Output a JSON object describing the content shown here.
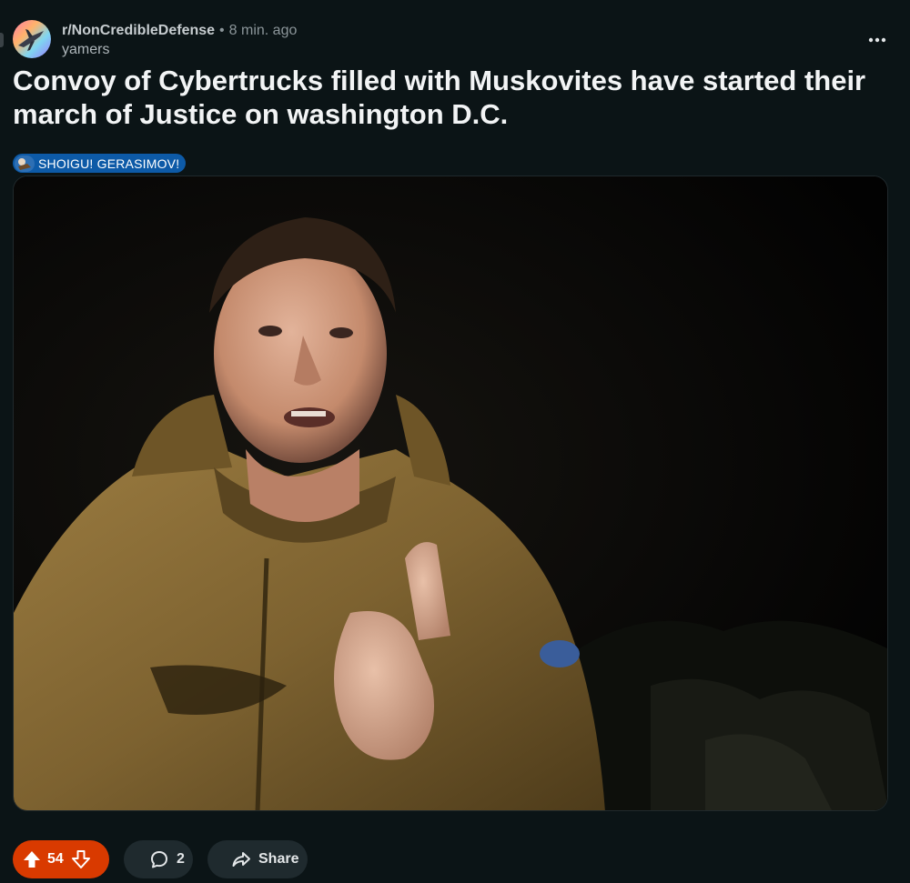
{
  "post": {
    "subreddit": "r/NonCredibleDefense",
    "separator": "•",
    "time_ago": "8 min. ago",
    "author": "yamers",
    "title": "Convoy of Cybertrucks filled with Muskovites have started their march of Justice on washington D.C.",
    "flair": {
      "text": "SHOIGU! GERASIMOV!",
      "color": "#0d5aa7"
    },
    "image_alt": "Photo of a man in an olive hooded jacket pointing at the camera at night"
  },
  "actions": {
    "vote_count": "54",
    "comment_count": "2",
    "share_label": "Share"
  },
  "icons": {
    "more": "more-options-icon",
    "upvote": "upvote-arrow-icon",
    "downvote": "downvote-arrow-icon",
    "comment": "comment-bubble-icon",
    "share": "share-arrow-icon"
  },
  "colors": {
    "background": "#0b1416",
    "upvoted_accent": "#d93a00",
    "pill_background": "#1f2a2e"
  }
}
